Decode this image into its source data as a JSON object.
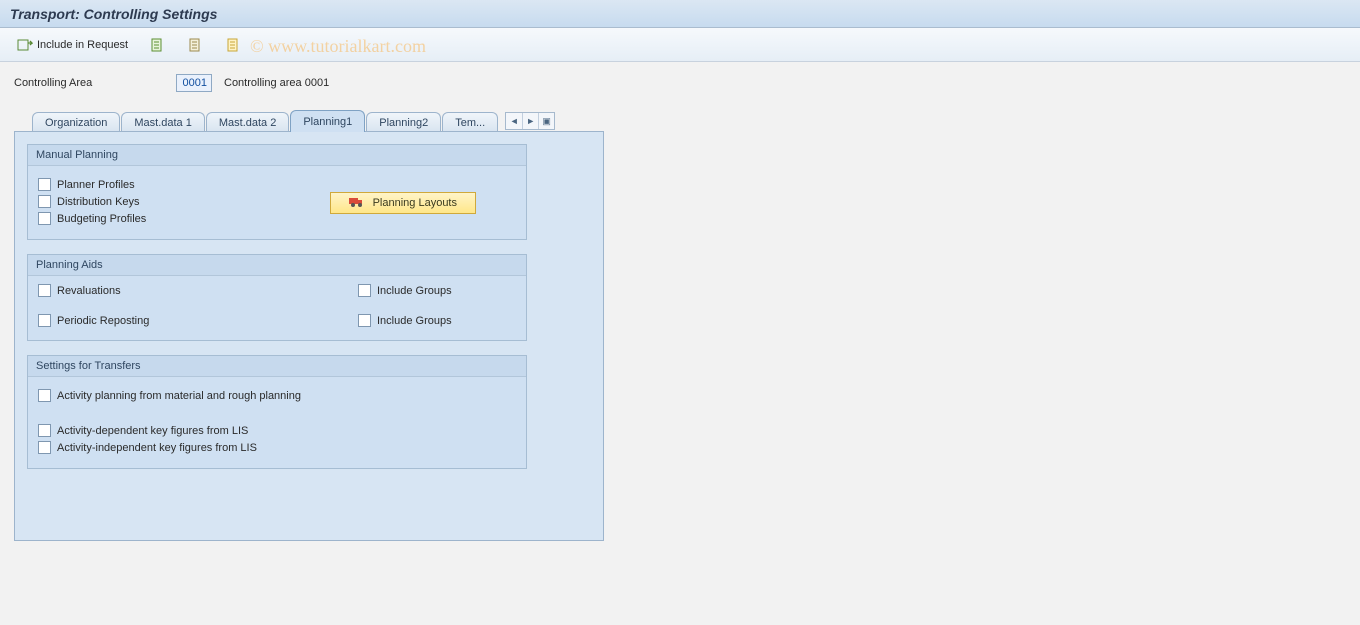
{
  "title": "Transport: Controlling Settings",
  "toolbar": {
    "include_label": "Include in Request"
  },
  "param": {
    "label": "Controlling Area",
    "value": "0001",
    "desc": "Controlling area 0001"
  },
  "tabs": [
    {
      "label": "Organization"
    },
    {
      "label": "Mast.data 1"
    },
    {
      "label": "Mast.data 2"
    },
    {
      "label": "Planning1"
    },
    {
      "label": "Planning2"
    },
    {
      "label": "Tem..."
    }
  ],
  "group_manual": {
    "title": "Manual Planning",
    "chk_profiles": "Planner Profiles",
    "chk_distkeys": "Distribution Keys",
    "chk_budget": "Budgeting Profiles",
    "btn_layouts": "Planning Layouts"
  },
  "group_aids": {
    "title": "Planning Aids",
    "chk_reval": "Revaluations",
    "chk_include1": "Include Groups",
    "chk_periodic": "Periodic Reposting",
    "chk_include2": "Include Groups"
  },
  "group_transfers": {
    "title": "Settings for Transfers",
    "chk_activity_material": "Activity planning from material and rough planning",
    "chk_act_dep": "Activity-dependent key figures from LIS",
    "chk_act_indep": "Activity-independent key figures from LIS"
  },
  "watermark": "©  www.tutorialkart.com"
}
